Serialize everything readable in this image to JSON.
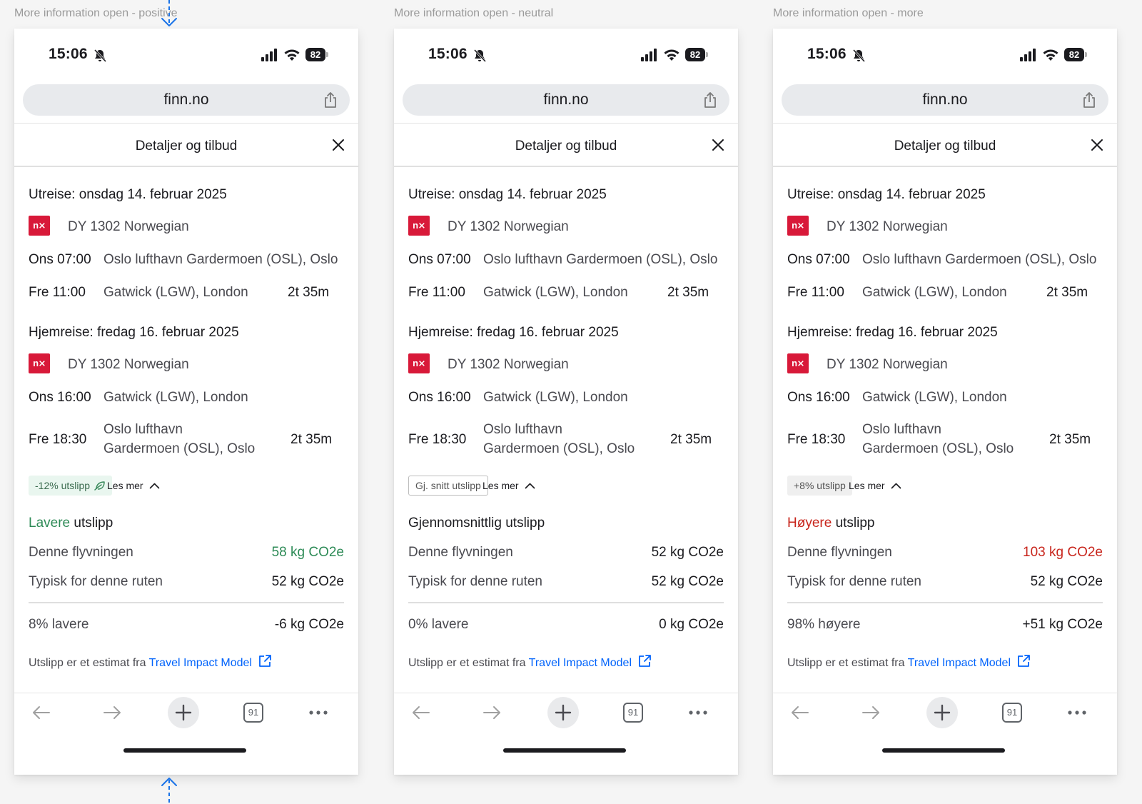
{
  "frames": [
    {
      "label": "More information open - positive",
      "status": {
        "time": "15:06",
        "battery": "82"
      },
      "browser": {
        "url": "finn.no",
        "tab_count": "91"
      },
      "modal": {
        "title": "Detaljer og tilbud"
      },
      "outbound": {
        "title": "Utreise: onsdag 14. februar 2025",
        "logo": "n⨯",
        "flight": "DY 1302 Norwegian",
        "dep_time": "Ons 07:00",
        "dep_place": "Oslo lufthavn Gardermoen (OSL), Oslo",
        "arr_time": "Fre 11:00",
        "arr_place": "Gatwick (LGW), London",
        "duration": "2t 35m"
      },
      "return": {
        "title": "Hjemreise: fredag 16. februar 2025",
        "logo": "n⨯",
        "flight": "DY 1302 Norwegian",
        "dep_time": "Ons 16:00",
        "dep_place": "Gatwick (LGW), London",
        "arr_time": "Fre 18:30",
        "arr_place": "Oslo lufthavn Gardermoen (OSL), Oslo",
        "duration": "2t 35m"
      },
      "badge": {
        "text": "-12% utslipp",
        "variant": "positive",
        "leaf_icon": "leaf-icon"
      },
      "les_mer": "Les mer",
      "emission": {
        "title_accent": "Lavere",
        "title_rest": " utslipp",
        "accent_color": "#2e8b57",
        "this_flight_label": "Denne flyvningen",
        "this_flight_value": "58 kg CO2e",
        "typical_label": "Typisk for denne ruten",
        "typical_value": "52 kg CO2e",
        "diff_label": "8% lavere",
        "diff_value": "-6 kg CO2e"
      },
      "footnote": {
        "prefix": "Utslipp er et estimat fra ",
        "link": "Travel Impact Model"
      }
    },
    {
      "label": "More information open - neutral",
      "status": {
        "time": "15:06",
        "battery": "82"
      },
      "browser": {
        "url": "finn.no",
        "tab_count": "91"
      },
      "modal": {
        "title": "Detaljer og tilbud"
      },
      "outbound": {
        "title": "Utreise: onsdag 14. februar 2025",
        "logo": "n⨯",
        "flight": "DY 1302 Norwegian",
        "dep_time": "Ons 07:00",
        "dep_place": "Oslo lufthavn Gardermoen (OSL), Oslo",
        "arr_time": "Fre 11:00",
        "arr_place": "Gatwick (LGW), London",
        "duration": "2t 35m"
      },
      "return": {
        "title": "Hjemreise: fredag 16. februar 2025",
        "logo": "n⨯",
        "flight": "DY 1302 Norwegian",
        "dep_time": "Ons 16:00",
        "dep_place": "Gatwick (LGW), London",
        "arr_time": "Fre 18:30",
        "arr_place": "Oslo lufthavn Gardermoen (OSL), Oslo",
        "duration": "2t 35m"
      },
      "badge": {
        "text": "Gj. snitt utslipp",
        "variant": "neutral"
      },
      "les_mer": "Les mer",
      "emission": {
        "title_accent": "",
        "title_rest": "Gjennomsnittlig utslipp",
        "accent_color": "#1b1b1f",
        "this_flight_label": "Denne flyvningen",
        "this_flight_value": "52 kg CO2e",
        "typical_label": "Typisk for denne ruten",
        "typical_value": "52 kg CO2e",
        "diff_label": "0% lavere",
        "diff_value": "0 kg CO2e"
      },
      "footnote": {
        "prefix": "Utslipp er et estimat fra ",
        "link": "Travel Impact Model"
      }
    },
    {
      "label": "More information open - more",
      "status": {
        "time": "15:06",
        "battery": "82"
      },
      "browser": {
        "url": "finn.no",
        "tab_count": "91"
      },
      "modal": {
        "title": "Detaljer og tilbud"
      },
      "outbound": {
        "title": "Utreise: onsdag 14. februar 2025",
        "logo": "n⨯",
        "flight": "DY 1302 Norwegian",
        "dep_time": "Ons 07:00",
        "dep_place": "Oslo lufthavn Gardermoen (OSL), Oslo",
        "arr_time": "Fre 11:00",
        "arr_place": "Gatwick (LGW), London",
        "duration": "2t 35m"
      },
      "return": {
        "title": "Hjemreise: fredag 16. februar 2025",
        "logo": "n⨯",
        "flight": "DY 1302 Norwegian",
        "dep_time": "Ons 16:00",
        "dep_place": "Gatwick (LGW), London",
        "arr_time": "Fre 18:30",
        "arr_place": "Oslo lufthavn Gardermoen (OSL), Oslo",
        "duration": "2t 35m"
      },
      "badge": {
        "text": "+8% utslipp",
        "variant": "more"
      },
      "les_mer": "Les mer",
      "emission": {
        "title_accent": "Høyere",
        "title_rest": " utslipp",
        "accent_color": "#c8251c",
        "this_flight_label": "Denne flyvningen",
        "this_flight_value": "103 kg CO2e",
        "typical_label": "Typisk for denne ruten",
        "typical_value": "52 kg CO2e",
        "diff_label": "98% høyere",
        "diff_value": "+51 kg CO2e"
      },
      "footnote": {
        "prefix": "Utslipp er et estimat fra ",
        "link": "Travel Impact Model"
      }
    }
  ],
  "colors": {
    "link": "#0063fb",
    "brand_norwegian": "#d81939",
    "annotation_arrow": "#1a73e8"
  },
  "icons": [
    "bell-slash-icon",
    "signal-icon",
    "wifi-icon",
    "share-icon",
    "close-icon",
    "leaf-icon",
    "chevron-up-icon",
    "external-link-icon",
    "back-icon",
    "forward-icon",
    "plus-icon",
    "tabs-icon",
    "more-icon"
  ]
}
